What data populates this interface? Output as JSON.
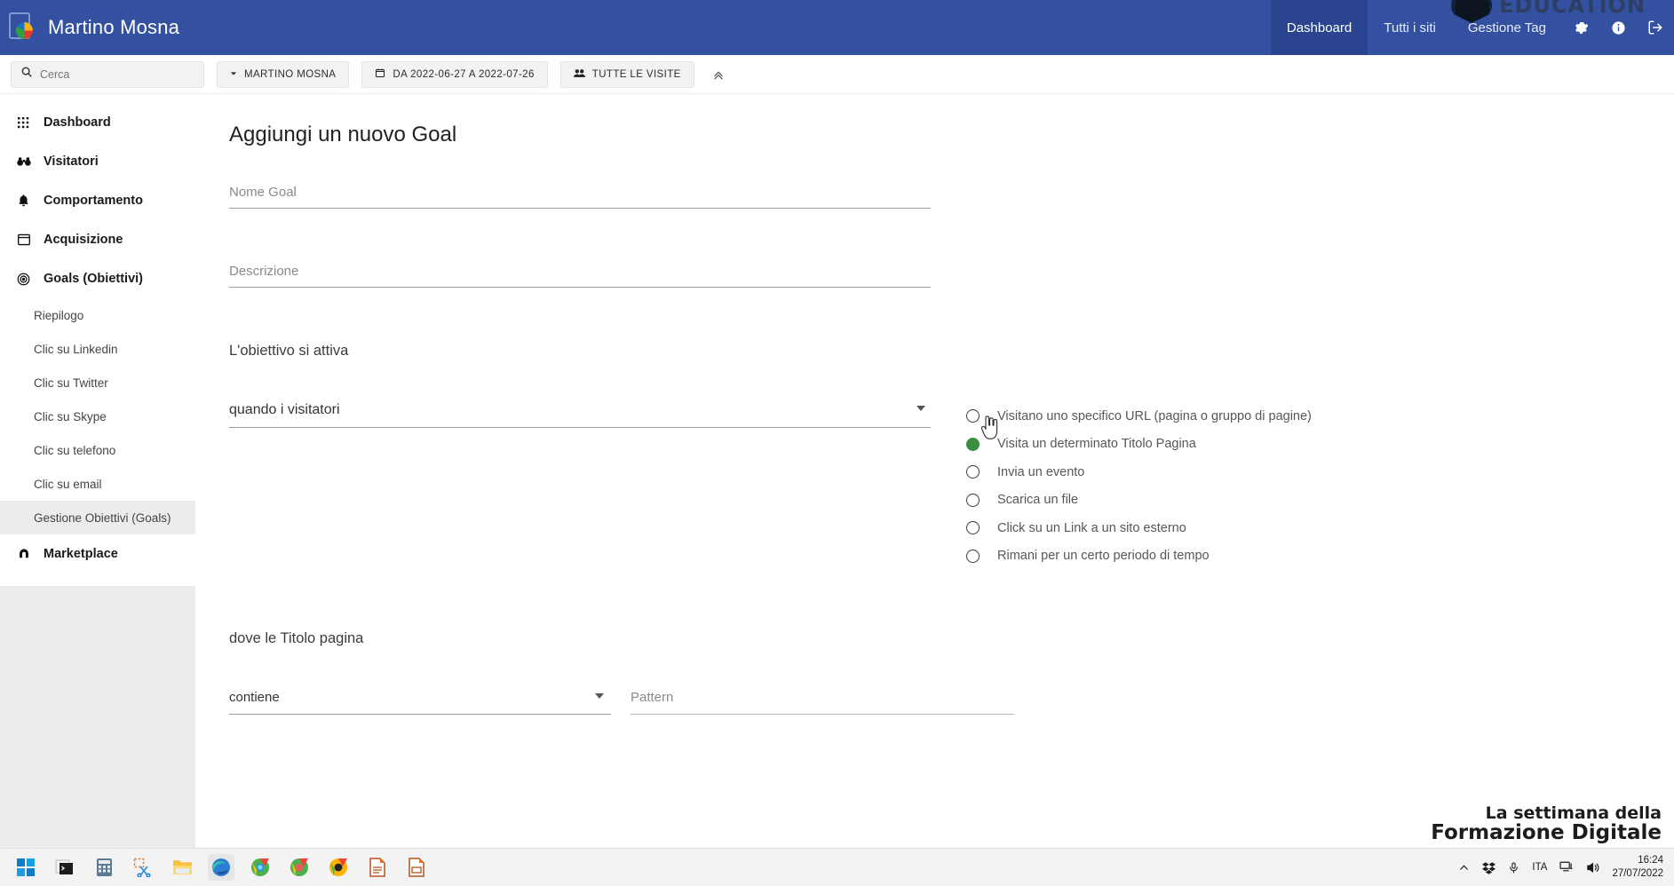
{
  "topbar": {
    "brand_title": "Martino Mosna",
    "logo_icon": "matomo-logo-icon",
    "nav": [
      {
        "label": "Dashboard",
        "active": true
      },
      {
        "label": "Tutti i siti",
        "active": false
      },
      {
        "label": "Gestione Tag",
        "active": false
      }
    ],
    "icons": [
      {
        "name": "gear-icon"
      },
      {
        "name": "info-icon"
      },
      {
        "name": "logout-icon"
      }
    ],
    "watermark": "EDUCATION",
    "bar_color": "#3450a1",
    "active_tab_color": "#2b4490"
  },
  "toolbar": {
    "search_placeholder": "Cerca",
    "search_value": "",
    "site_selector": "MARTINO MOSNA",
    "date_range": "DA 2022-06-27 A 2022-07-26",
    "segment": "TUTTE LE VISITE",
    "collapse_icon": "double-chevron-up-icon"
  },
  "sidebar": {
    "items": [
      {
        "label": "Dashboard",
        "icon": "grid-icon",
        "type": "main"
      },
      {
        "label": "Visitatori",
        "icon": "binoculars-icon",
        "type": "main"
      },
      {
        "label": "Comportamento",
        "icon": "bell-icon",
        "type": "main"
      },
      {
        "label": "Acquisizione",
        "icon": "window-icon",
        "type": "main"
      },
      {
        "label": "Goals (Obiettivi)",
        "icon": "target-icon",
        "type": "main"
      },
      {
        "label": "Riepilogo",
        "type": "sub",
        "selected": false
      },
      {
        "label": "Clic su Linkedin",
        "type": "sub",
        "selected": false
      },
      {
        "label": "Clic su Twitter",
        "type": "sub",
        "selected": false
      },
      {
        "label": "Clic su Skype",
        "type": "sub",
        "selected": false
      },
      {
        "label": "Clic su telefono",
        "type": "sub",
        "selected": false
      },
      {
        "label": "Clic su email",
        "type": "sub",
        "selected": false
      },
      {
        "label": "Gestione Obiettivi (Goals)",
        "type": "sub",
        "selected": true
      },
      {
        "label": "Marketplace",
        "icon": "plug-icon",
        "type": "main"
      }
    ]
  },
  "main": {
    "page_title": "Aggiungi un nuovo Goal",
    "name_field": {
      "label": "Nome Goal",
      "value": ""
    },
    "description_field": {
      "label": "Descrizione",
      "value": ""
    },
    "trigger_section_label": "L'obiettivo si attiva",
    "trigger_select": {
      "value": "quando i visitatori"
    },
    "trigger_options": [
      {
        "label": "Visitano uno specifico URL (pagina o gruppo di pagine)",
        "checked": false
      },
      {
        "label": "Visita un determinato Titolo Pagina",
        "checked": true
      },
      {
        "label": "Invia un evento",
        "checked": false
      },
      {
        "label": "Scarica un file",
        "checked": false
      },
      {
        "label": "Click su un Link a un sito esterno",
        "checked": false
      },
      {
        "label": "Rimani per un certo periodo di tempo",
        "checked": false
      }
    ],
    "where_label": "dove le Titolo pagina",
    "match_select": {
      "value": "contiene"
    },
    "pattern_field": {
      "label": "Pattern",
      "value": ""
    },
    "selected_radio_color": "#3a8f3e"
  },
  "overlay": {
    "bottom_line1": "La settimana della",
    "bottom_line2": "Formazione Digitale"
  },
  "taskbar": {
    "apps": [
      {
        "name": "start-icon"
      },
      {
        "name": "terminal-icon"
      },
      {
        "name": "calculator-icon"
      },
      {
        "name": "snipping-tool-icon"
      },
      {
        "name": "file-explorer-icon"
      },
      {
        "name": "edge-browser-icon",
        "active": true
      },
      {
        "name": "chrome-browser-icon"
      },
      {
        "name": "chrome-browser-icon"
      },
      {
        "name": "chrome-browser-icon"
      },
      {
        "name": "libreoffice-writer-icon"
      },
      {
        "name": "libreoffice-impress-icon"
      }
    ],
    "tray": {
      "overflow_icon": "chevron-up-icon",
      "dropbox_icon": "dropbox-icon",
      "mic_icon": "microphone-icon",
      "language": "ITA",
      "network_icon": "network-icon",
      "volume_icon": "volume-icon",
      "time": "16:24",
      "date": "27/07/2022"
    }
  }
}
